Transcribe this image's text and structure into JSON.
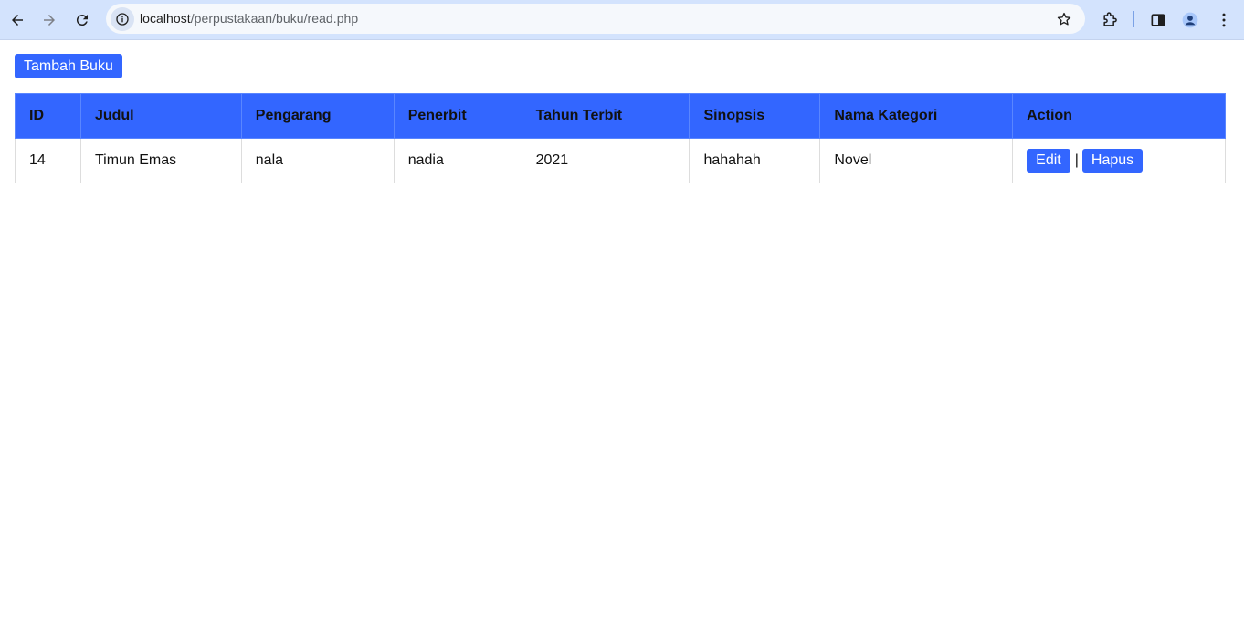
{
  "browser": {
    "url_host": "localhost",
    "url_path": "/perpustakaan/buku/read.php"
  },
  "page": {
    "add_button": "Tambah Buku"
  },
  "table": {
    "headers": [
      "ID",
      "Judul",
      "Pengarang",
      "Penerbit",
      "Tahun Terbit",
      "Sinopsis",
      "Nama Kategori",
      "Action"
    ],
    "rows": [
      {
        "id": "14",
        "judul": "Timun Emas",
        "pengarang": "nala",
        "penerbit": "nadia",
        "tahun_terbit": "2021",
        "sinopsis": "hahahah",
        "nama_kategori": "Novel",
        "edit_label": "Edit",
        "separator": "|",
        "delete_label": "Hapus"
      }
    ]
  },
  "colors": {
    "accent": "#3366ff",
    "chrome": "#d3e3fd"
  }
}
